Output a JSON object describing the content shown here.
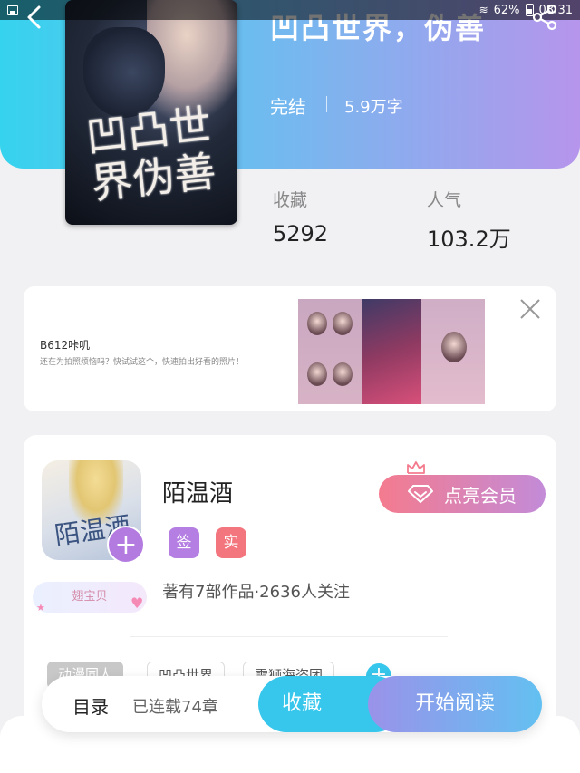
{
  "status_bar": {
    "battery": "62%",
    "time": "08:31"
  },
  "book": {
    "title": "凹凸世界，伪善",
    "status": "完结",
    "words": "5.9万字",
    "cover_text": "凹凸世界伪善"
  },
  "stats": {
    "favorites_label": "收藏",
    "favorites_value": "5292",
    "popularity_label": "人气",
    "popularity_value": "103.2万"
  },
  "ad": {
    "title": "B612咔叽",
    "description": "还在为拍照烦恼吗？快试试这个，快速拍出好看的照片！"
  },
  "author": {
    "name": "陌温酒",
    "avatar_text": "陌温酒",
    "badges": [
      {
        "label": "签",
        "color": "#b47ee2"
      },
      {
        "label": "实",
        "color": "#f3757d"
      }
    ],
    "vip_label": "点亮会员",
    "stats": "著有7部作品·2636人关注",
    "fan_badge": "翅宝贝",
    "follow_symbol": "+"
  },
  "tags": [
    {
      "label": "动漫同人"
    },
    {
      "label": "凹凸世界"
    },
    {
      "label": "雷狮海盗团"
    }
  ],
  "bottom_bar": {
    "catalog": "目录",
    "serial": "已连载74章",
    "collect": "收藏",
    "read": "开始阅读"
  },
  "colors": {
    "header_start": "#36d3ee",
    "header_end": "#b695ec",
    "accent_blue": "#37c7ec",
    "vip_pink": "#f47b8e",
    "purple": "#b37ae0"
  }
}
